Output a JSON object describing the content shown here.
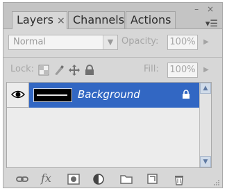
{
  "tabs": [
    {
      "label": "Layers",
      "close": "×"
    },
    {
      "label": "Channels"
    },
    {
      "label": "Actions"
    }
  ],
  "window_controls": "– ×",
  "panel_menu_icon": "menu-icon",
  "blend_mode": {
    "value": "Normal"
  },
  "opacity": {
    "label": "Opacity:",
    "value": "100%"
  },
  "lock": {
    "label": "Lock:",
    "icons": [
      "lock-transparent-icon",
      "lock-image-icon",
      "lock-position-icon",
      "lock-all-icon"
    ]
  },
  "fill": {
    "label": "Fill:",
    "value": "100%"
  },
  "layers": [
    {
      "name": "Background",
      "visible": true,
      "locked": true,
      "selected": true
    }
  ],
  "bottom_icons": [
    "link-icon",
    "fx-icon",
    "mask-icon",
    "adjustment-icon",
    "group-icon",
    "new-layer-icon",
    "trash-icon"
  ],
  "fx_label": "fx",
  "colors": {
    "selection": "#3267c3",
    "panel": "#d7d7d7"
  }
}
